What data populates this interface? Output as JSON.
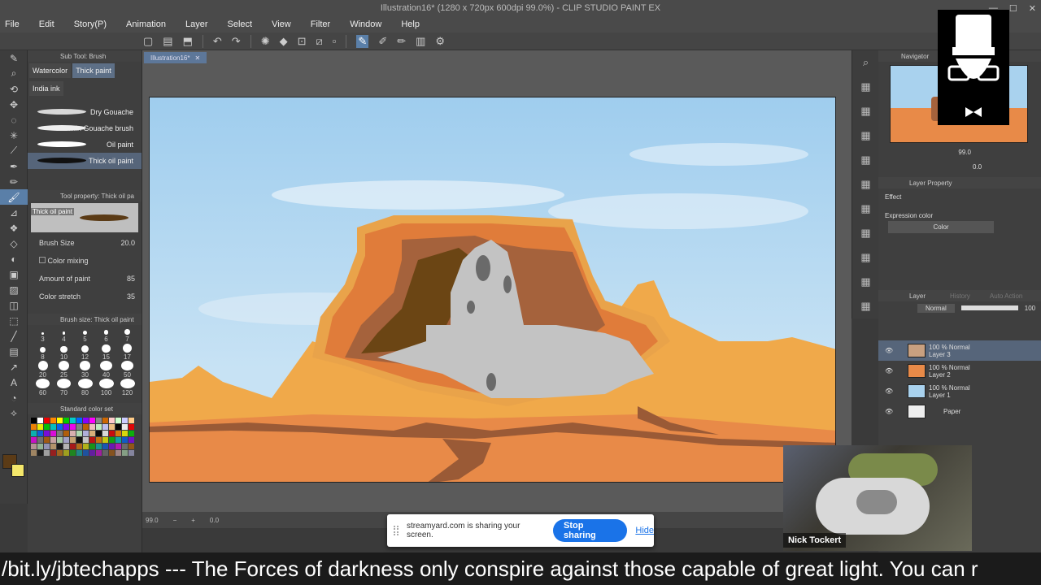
{
  "window": {
    "title": "Illustration16* (1280 x 720px 600dpi 99.0%) - CLIP STUDIO PAINT EX"
  },
  "menu": [
    "File",
    "Edit",
    "Story(P)",
    "Animation",
    "Layer",
    "Select",
    "View",
    "Filter",
    "Window",
    "Help"
  ],
  "subtool": {
    "header": "Sub Tool: Brush",
    "tabs": [
      "Watercolor",
      "Thick paint",
      "India ink"
    ],
    "brushes": [
      "Dry Gouache",
      "Thin Gouache brush",
      "Oil paint",
      "Thick oil paint"
    ],
    "brush_colors": [
      "#d8d8d8",
      "#eeeeee",
      "#ffffff",
      "#111111"
    ]
  },
  "tool_property": {
    "header": "Tool property: Thick oil pa",
    "preset_name": "Thick oil paint",
    "brush_size_label": "Brush Size",
    "brush_size_value": "20.0",
    "color_mixing_label": "Color mixing",
    "amount_of_paint_label": "Amount of paint",
    "amount_of_paint_value": "85",
    "color_stretch_label": "Color stretch",
    "color_stretch_value": "35"
  },
  "brush_size_panel": {
    "header": "Brush size: Thick oil paint",
    "sizes": [
      "3",
      "4",
      "5",
      "6",
      "7",
      "8",
      "10",
      "12",
      "15",
      "17",
      "20",
      "25",
      "30",
      "40",
      "50",
      "60",
      "70",
      "80",
      "100",
      "120"
    ]
  },
  "color_set": {
    "header": "Standard color set"
  },
  "colors": {
    "main": "#5b3b16",
    "sub": "#f4e76b",
    "accent": "#5a7fa8"
  },
  "document": {
    "tab_label": "Illustration16*"
  },
  "status": {
    "zoom": "99.0",
    "rotation": "0.0"
  },
  "navigator": {
    "header": "Navigator",
    "zoom": "99.0",
    "rotation": "0.0"
  },
  "layer_property": {
    "header": "Layer Property",
    "effect_label": "Effect",
    "expression_color_label": "Expression color",
    "expression_color_value": "Color"
  },
  "layers_panel": {
    "tabs": [
      "Layer",
      "History",
      "Auto Action"
    ],
    "blend_mode": "Normal",
    "opacity": "100",
    "layers": [
      {
        "mode": "100 % Normal",
        "name": "Layer 3"
      },
      {
        "mode": "100 % Normal",
        "name": "Layer 2"
      },
      {
        "mode": "100 % Normal",
        "name": "Layer 1"
      },
      {
        "mode": "",
        "name": "Paper"
      }
    ]
  },
  "webcam": {
    "name": "Nick Tockert"
  },
  "share_bar": {
    "message": "streamyard.com is sharing your screen.",
    "stop_label": "Stop sharing",
    "hide_label": "Hide"
  },
  "ticker": {
    "text": "/bit.ly/jbtechapps --- The Forces of darkness only conspire against those capable of great light. You can r"
  }
}
